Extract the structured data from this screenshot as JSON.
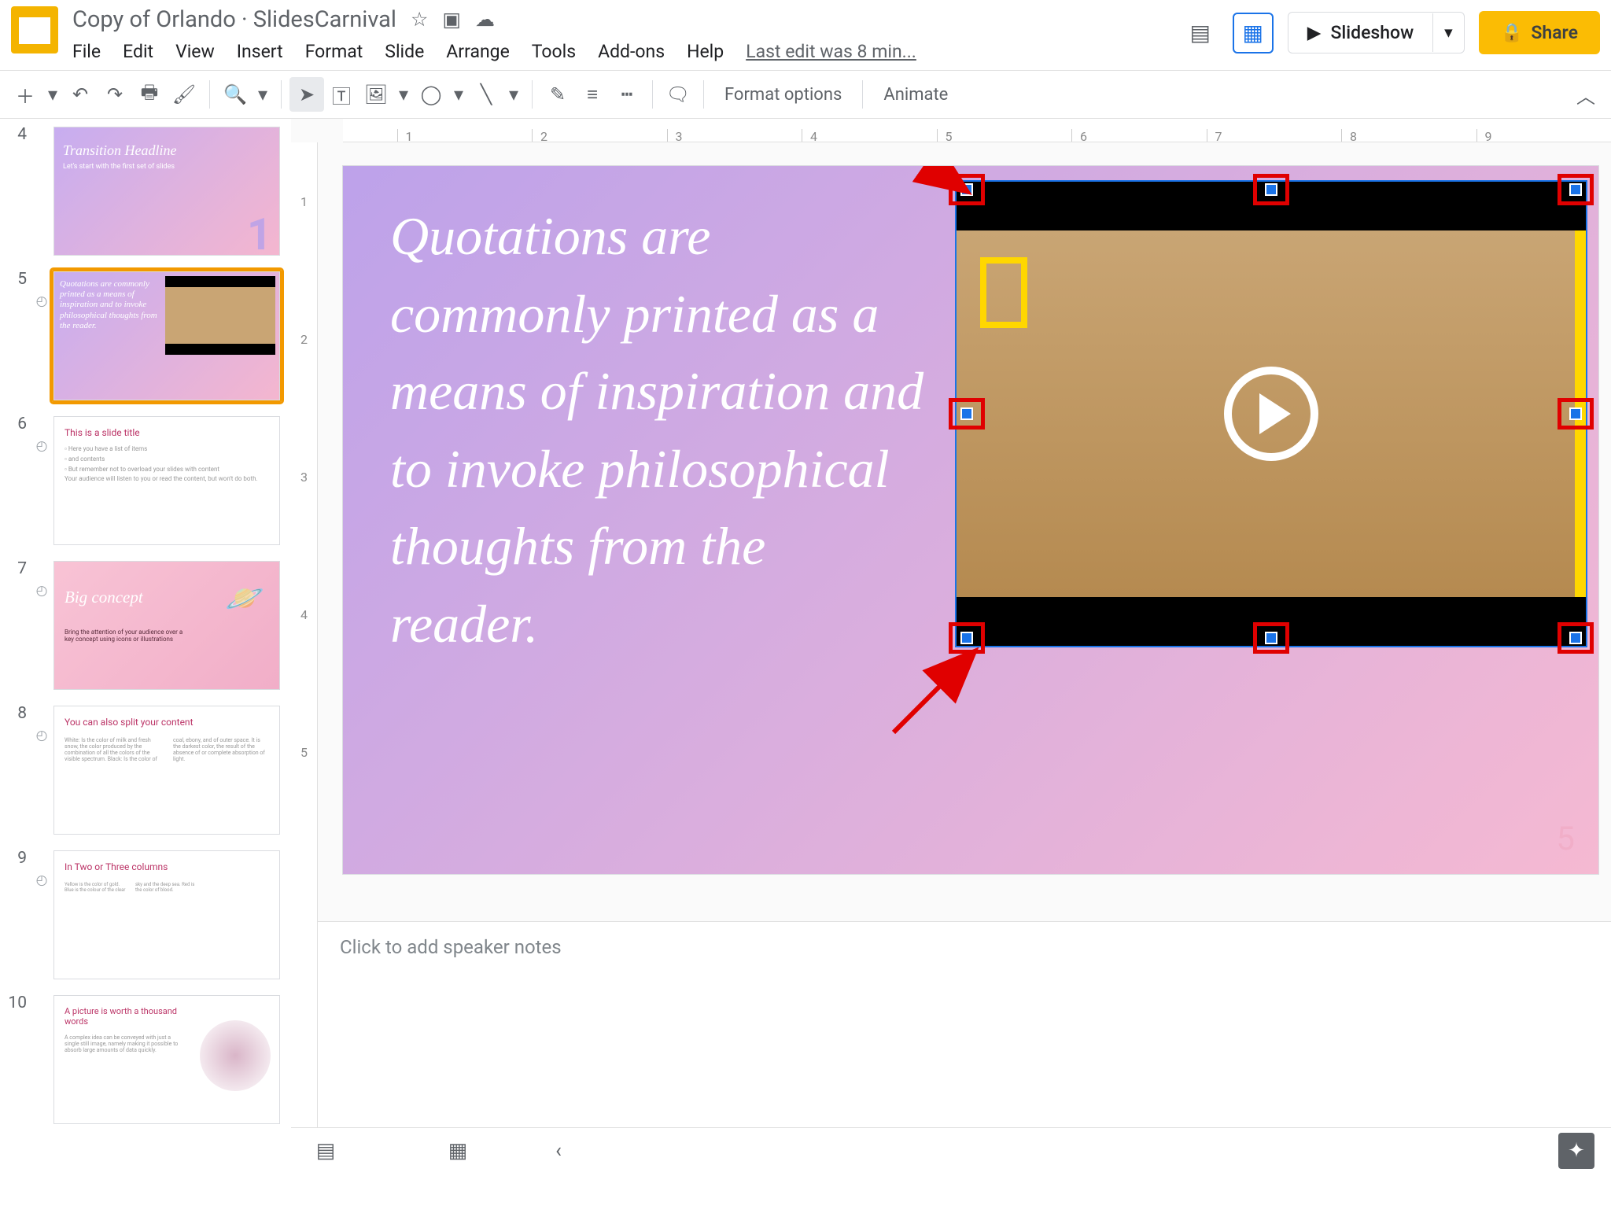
{
  "doc": {
    "name": "Copy of Orlando · SlidesCarnival",
    "last_edit": "Last edit was 8 min..."
  },
  "menus": {
    "file": "File",
    "edit": "Edit",
    "view": "View",
    "insert": "Insert",
    "format": "Format",
    "slide": "Slide",
    "arrange": "Arrange",
    "tools": "Tools",
    "addons": "Add-ons",
    "help": "Help"
  },
  "header_buttons": {
    "slideshow": "Slideshow",
    "share": "Share"
  },
  "toolbar": {
    "format_options": "Format options",
    "animate": "Animate"
  },
  "ruler_h": [
    "1",
    "2",
    "3",
    "4",
    "5",
    "6",
    "7",
    "8",
    "9"
  ],
  "ruler_v": [
    "1",
    "2",
    "3",
    "4",
    "5"
  ],
  "slide": {
    "quote_text": "Quotations are commonly printed as a means of inspiration and to invoke philosophical thoughts from the reader.",
    "number": "5"
  },
  "notes": {
    "placeholder": "Click to add speaker notes"
  },
  "thumbs": [
    {
      "num": "4",
      "anim": false,
      "title": "Transition Headline",
      "body": "Let's start with the first set of slides",
      "bignum": "1",
      "variant": "purple"
    },
    {
      "num": "5",
      "anim": true,
      "selected": true,
      "title": "Quotations are commonly printed as a means of inspiration and to invoke philosophical thoughts from the reader.",
      "variant": "purple"
    },
    {
      "num": "6",
      "anim": true,
      "title": "This is a slide title",
      "variant": "white"
    },
    {
      "num": "7",
      "anim": true,
      "title": "Big concept",
      "body": "Bring the attention of your audience over a key concept using icons or illustrations",
      "variant": "pink"
    },
    {
      "num": "8",
      "anim": true,
      "title": "You can also split your content",
      "variant": "white"
    },
    {
      "num": "9",
      "anim": true,
      "title": "In Two or Three columns",
      "variant": "white"
    },
    {
      "num": "10",
      "anim": false,
      "title": "A picture is worth a thousand words",
      "body": "A complex idea can be conveyed with just a single still image, namely making it possible to absorb large amounts of data quickly.",
      "variant": "white"
    }
  ]
}
